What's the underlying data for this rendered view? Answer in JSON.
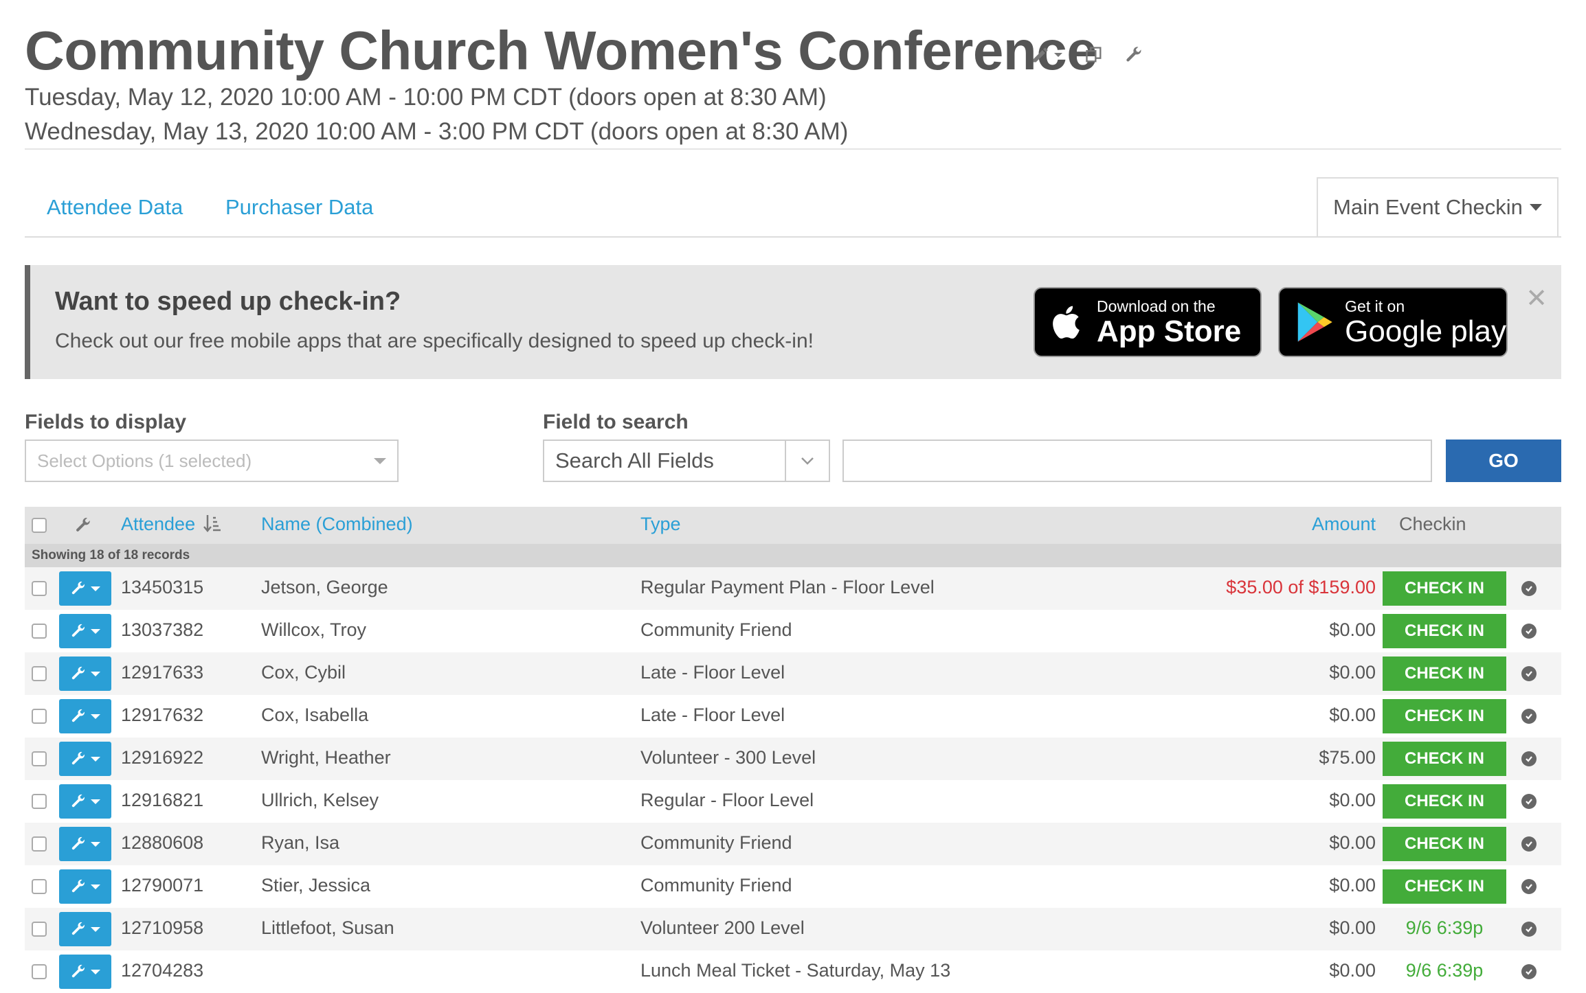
{
  "event": {
    "title": "Community Church Women's Conference",
    "dates": [
      "Tuesday, May 12, 2020 10:00 AM - 10:00 PM CDT (doors open at 8:30 AM)",
      "Wednesday, May 13, 2020 10:00 AM - 3:00 PM CDT (doors open at 8:30 AM)"
    ]
  },
  "tabs": {
    "attendee": "Attendee Data",
    "purchaser": "Purchaser Data",
    "dropdown": "Main Event Checkin"
  },
  "banner": {
    "heading": "Want to speed up check-in?",
    "text": "Check out our free mobile apps that are specifically designed to speed up check-in!",
    "appstore_small": "Download on the",
    "appstore_big": "App Store",
    "googleplay_small": "Get it on",
    "googleplay_big": "Google play"
  },
  "filters": {
    "fields_label": "Fields to display",
    "fields_placeholder": "Select Options (1 selected)",
    "search_label": "Field to search",
    "search_field": "Search All Fields",
    "go": "GO"
  },
  "table": {
    "headers": {
      "attendee": "Attendee",
      "name": "Name (Combined)",
      "type": "Type",
      "amount": "Amount",
      "checkin": "Checkin"
    },
    "records_text": "Showing 18 of 18 records",
    "checkin_label": "CHECK IN",
    "rows": [
      {
        "id": "13450315",
        "name": "Jetson, George",
        "type": "Regular Payment Plan - Floor Level",
        "amount": "$35.00 of $159.00",
        "due": true,
        "checked": ""
      },
      {
        "id": "13037382",
        "name": "Willcox, Troy",
        "type": "Community Friend",
        "amount": "$0.00",
        "due": false,
        "checked": ""
      },
      {
        "id": "12917633",
        "name": "Cox, Cybil",
        "type": "Late - Floor Level",
        "amount": "$0.00",
        "due": false,
        "checked": ""
      },
      {
        "id": "12917632",
        "name": "Cox, Isabella",
        "type": "Late - Floor Level",
        "amount": "$0.00",
        "due": false,
        "checked": ""
      },
      {
        "id": "12916922",
        "name": "Wright, Heather",
        "type": "Volunteer - 300 Level",
        "amount": "$75.00",
        "due": false,
        "checked": ""
      },
      {
        "id": "12916821",
        "name": "Ullrich, Kelsey",
        "type": "Regular - Floor Level",
        "amount": "$0.00",
        "due": false,
        "checked": ""
      },
      {
        "id": "12880608",
        "name": "Ryan, Isa",
        "type": "Community Friend",
        "amount": "$0.00",
        "due": false,
        "checked": ""
      },
      {
        "id": "12790071",
        "name": "Stier, Jessica",
        "type": "Community Friend",
        "amount": "$0.00",
        "due": false,
        "checked": ""
      },
      {
        "id": "12710958",
        "name": "Littlefoot, Susan",
        "type": "Volunteer 200 Level",
        "amount": "$0.00",
        "due": false,
        "checked": "9/6 6:39p"
      },
      {
        "id": "12704283",
        "name": "",
        "type": "Lunch Meal Ticket - Saturday, May 13",
        "amount": "$0.00",
        "due": false,
        "checked": "9/6 6:39p"
      }
    ]
  },
  "colors": {
    "link": "#2a9fd6",
    "go_button": "#2a6ab0",
    "checkin_button": "#43ac3a",
    "amount_due": "#d9343a"
  },
  "icons": [
    "pencil-icon",
    "copy-icon",
    "wrench-icon",
    "sort-icon",
    "apple-icon",
    "google-play-icon",
    "close-icon",
    "check-circle-icon"
  ]
}
